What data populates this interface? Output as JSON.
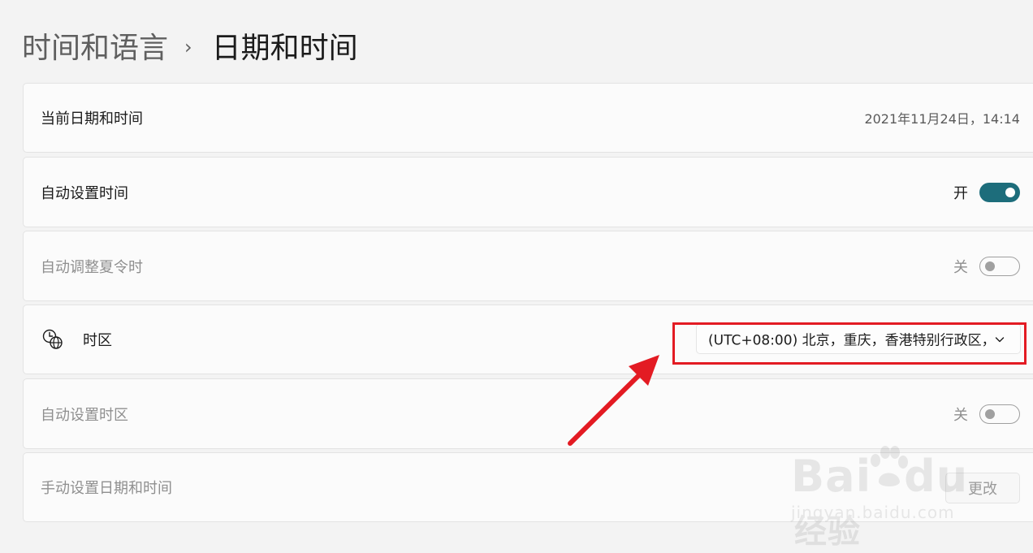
{
  "breadcrumb": {
    "parent": "时间和语言",
    "separator": "›",
    "current": "日期和时间"
  },
  "rows": {
    "current_datetime": {
      "label": "当前日期和时间",
      "value": "2021年11月24日，14:14"
    },
    "auto_time": {
      "label": "自动设置时间",
      "state_label": "开",
      "on": true
    },
    "auto_dst": {
      "label": "自动调整夏令时",
      "state_label": "关",
      "on": false,
      "disabled": true
    },
    "timezone": {
      "label": "时区",
      "icon": "clock-globe-icon",
      "selected": "(UTC+08:00) 北京，重庆，香港特别行政区，"
    },
    "auto_timezone": {
      "label": "自动设置时区",
      "state_label": "关",
      "on": false,
      "disabled": true
    },
    "manual_datetime": {
      "label": "手动设置日期和时间",
      "button_label": "更改",
      "disabled": true
    }
  },
  "annotation": {
    "box_color": "#e31b23",
    "arrow_color": "#e31b23"
  },
  "watermark": {
    "main": "Bai",
    "main_tail": "du",
    "brand": "经验",
    "sub": "jingyan.baidu.com"
  },
  "colors": {
    "accent": "#1d6d7b",
    "background": "#f3f3f3",
    "card": "#fbfbfb"
  }
}
